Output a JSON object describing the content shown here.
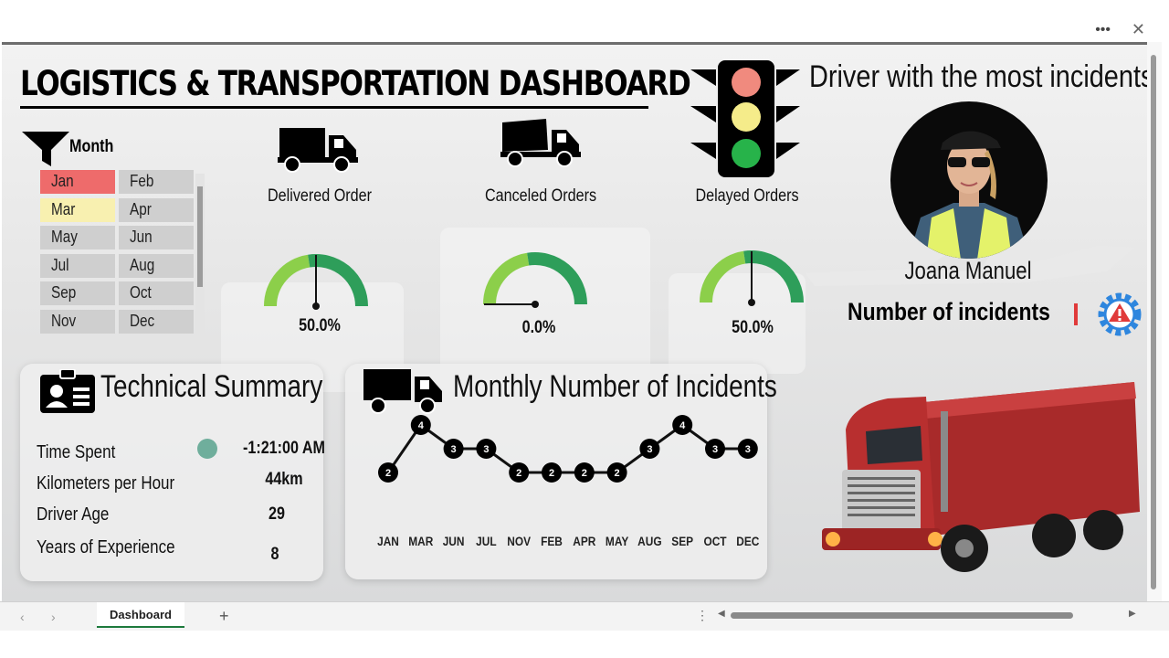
{
  "header": {
    "title": "LOGISTICS & TRANSPORTATION DASHBOARD"
  },
  "window": {
    "more_icon": "more-horizontal-icon",
    "close_icon": "close-icon"
  },
  "slicer": {
    "title": "Month",
    "icon": "filter-icon",
    "items": [
      {
        "label": "Jan",
        "state": "selected-red"
      },
      {
        "label": "Feb",
        "state": "normal"
      },
      {
        "label": "Mar",
        "state": "selected-yellow"
      },
      {
        "label": "Apr",
        "state": "normal"
      },
      {
        "label": "May",
        "state": "normal"
      },
      {
        "label": "Jun",
        "state": "normal"
      },
      {
        "label": "Jul",
        "state": "normal"
      },
      {
        "label": "Aug",
        "state": "normal"
      },
      {
        "label": "Sep",
        "state": "normal"
      },
      {
        "label": "Oct",
        "state": "normal"
      },
      {
        "label": "Nov",
        "state": "normal"
      },
      {
        "label": "Dec",
        "state": "normal"
      }
    ]
  },
  "kpis": [
    {
      "label": "Delivered Order",
      "value": "50.0%",
      "icon": "dump-truck-icon",
      "fraction": 0.5
    },
    {
      "label": "Canceled Orders",
      "value": "0.0%",
      "icon": "dump-truck-icon",
      "fraction": 0.0
    },
    {
      "label": "Delayed Orders",
      "value": "50.0%",
      "icon": "traffic-light-icon",
      "fraction": 0.5
    }
  ],
  "driver": {
    "heading": "Driver with the most incidents",
    "name": "Joana Manuel",
    "incidents_label": "Number of incidents",
    "incident_icon": "warning-gear-icon"
  },
  "technical_summary": {
    "title": "Technical Summary",
    "icon": "id-card-icon",
    "rows": [
      {
        "label": "Time Spent",
        "value": "-1:21:00 AM"
      },
      {
        "label": "Kilometers per Hour",
        "value": "44km"
      },
      {
        "label": "Driver Age",
        "value": "29"
      },
      {
        "label": "Years of Experience",
        "value": "8"
      }
    ],
    "status_color": "#6fae9c"
  },
  "incidents_chart": {
    "title": "Monthly Number of Incidents",
    "icon": "truck-icon"
  },
  "chart_data": {
    "type": "line",
    "title": "Monthly Number of Incidents",
    "categories": [
      "JAN",
      "MAR",
      "JUN",
      "JUL",
      "NOV",
      "FEB",
      "APR",
      "MAY",
      "AUG",
      "SEP",
      "OCT",
      "DEC"
    ],
    "values": [
      2,
      4,
      3,
      3,
      2,
      2,
      2,
      2,
      3,
      4,
      3,
      3
    ],
    "xlabel": "",
    "ylabel": "",
    "ylim": [
      2,
      4
    ],
    "grid": false,
    "data_labels": true,
    "color": "#111111"
  },
  "footer": {
    "sheet_tab": "Dashboard",
    "add_sheet": "+",
    "prev": "‹",
    "next": "›"
  },
  "colors": {
    "gauge_green": "#2e9e5a",
    "gauge_light": "#8ccf4a",
    "slicer_selected_red": "#ee6b6b",
    "slicer_selected_yellow": "#f8f0b0",
    "accent_blue": "#2e86de",
    "alert_red": "#e03a3a"
  }
}
